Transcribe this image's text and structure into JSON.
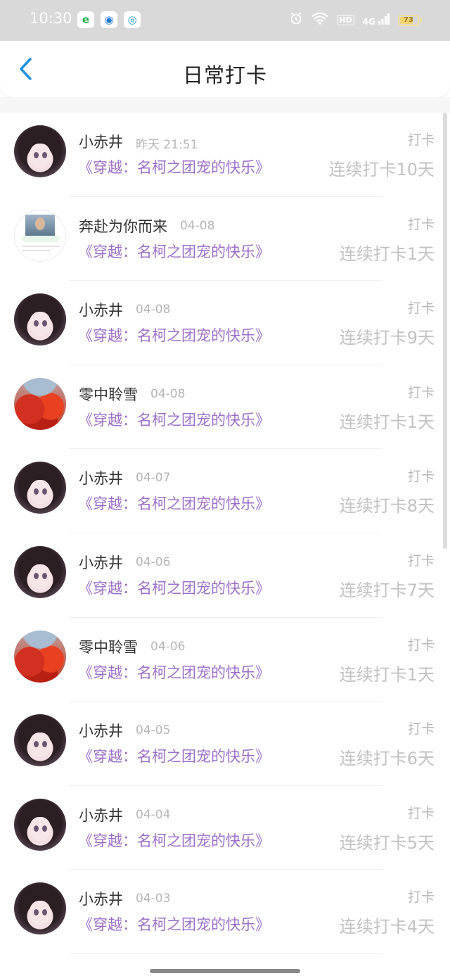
{
  "status_bar": {
    "time": "10:30",
    "apps": [
      {
        "icon": "edge-browser-icon",
        "glyph": "e"
      },
      {
        "icon": "circle-app-icon",
        "glyph": "◉"
      },
      {
        "icon": "qq-browser-icon",
        "glyph": "◎"
      }
    ],
    "hd_label": "HD",
    "signal_label": "4G",
    "battery_level": "73",
    "battery_percent": 73,
    "battery_color": "#f3d472"
  },
  "header": {
    "title": "日常打卡",
    "back_icon": "chevron-left-icon",
    "accent_color": "#1e90e0"
  },
  "colors": {
    "book_title": "#9b6fc9",
    "meta_gray": "#b5b5b5"
  },
  "items": [
    {
      "avatar": "anime",
      "name": "小赤井",
      "time": "昨天 21:51",
      "book": "《穿越：名柯之团宠的快乐》",
      "tag": "打卡",
      "streak": "连续打卡10天"
    },
    {
      "avatar": "photo",
      "name": "奔赴为你而来",
      "time": "04-08",
      "book": "《穿越：名柯之团宠的快乐》",
      "tag": "打卡",
      "streak": "连续打卡1天"
    },
    {
      "avatar": "anime",
      "name": "小赤井",
      "time": "04-08",
      "book": "《穿越：名柯之团宠的快乐》",
      "tag": "打卡",
      "streak": "连续打卡9天"
    },
    {
      "avatar": "flower",
      "name": "零中聆雪",
      "time": "04-08",
      "book": "《穿越：名柯之团宠的快乐》",
      "tag": "打卡",
      "streak": "连续打卡1天"
    },
    {
      "avatar": "anime",
      "name": "小赤井",
      "time": "04-07",
      "book": "《穿越：名柯之团宠的快乐》",
      "tag": "打卡",
      "streak": "连续打卡8天"
    },
    {
      "avatar": "anime",
      "name": "小赤井",
      "time": "04-06",
      "book": "《穿越：名柯之团宠的快乐》",
      "tag": "打卡",
      "streak": "连续打卡7天"
    },
    {
      "avatar": "flower",
      "name": "零中聆雪",
      "time": "04-06",
      "book": "《穿越：名柯之团宠的快乐》",
      "tag": "打卡",
      "streak": "连续打卡1天"
    },
    {
      "avatar": "anime",
      "name": "小赤井",
      "time": "04-05",
      "book": "《穿越：名柯之团宠的快乐》",
      "tag": "打卡",
      "streak": "连续打卡6天"
    },
    {
      "avatar": "anime",
      "name": "小赤井",
      "time": "04-04",
      "book": "《穿越：名柯之团宠的快乐》",
      "tag": "打卡",
      "streak": "连续打卡5天"
    },
    {
      "avatar": "anime",
      "name": "小赤井",
      "time": "04-03",
      "book": "《穿越：名柯之团宠的快乐》",
      "tag": "打卡",
      "streak": "连续打卡4天"
    }
  ]
}
